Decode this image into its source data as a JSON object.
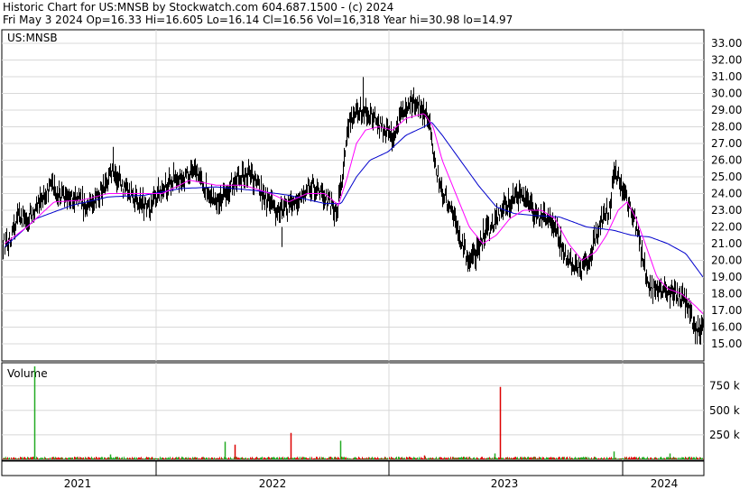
{
  "header": {
    "line1": "Historic Chart for US:MNSB by Stockwatch.com 604.687.1500 - (c) 2024",
    "line2": "Fri May  3 2024   Op=16.33   Hi=16.605   Lo=16.14   Cl=16.56   Vol=16,318   Year hi=30.98   lo=14.97"
  },
  "chart_data": [
    {
      "type": "line",
      "title": "US:MNSB",
      "ylim": [
        14.5,
        33.5
      ],
      "y_ticks": [
        "33.00",
        "32.00",
        "31.00",
        "30.00",
        "29.00",
        "28.00",
        "27.00",
        "26.00",
        "25.00",
        "24.00",
        "23.00",
        "22.00",
        "21.00",
        "20.00",
        "19.00",
        "18.00",
        "17.00",
        "16.00",
        "15.00"
      ],
      "x_tick_labels": [
        "2021",
        "2022",
        "2023",
        "2024"
      ],
      "grid": true,
      "colors": {
        "price": "#000000",
        "ma_short": "#ff00ff",
        "ma_long": "#0000cc"
      },
      "price_anchors": [
        [
          0,
          21.0
        ],
        [
          10,
          21.0
        ],
        [
          20,
          22.5
        ],
        [
          30,
          22.5
        ],
        [
          45,
          23.5
        ],
        [
          55,
          24.5
        ],
        [
          65,
          24.0
        ],
        [
          75,
          23.5
        ],
        [
          85,
          24.0
        ],
        [
          95,
          23.0
        ],
        [
          105,
          23.5
        ],
        [
          115,
          24.5
        ],
        [
          125,
          25.5
        ],
        [
          135,
          24.5
        ],
        [
          145,
          24.0
        ],
        [
          155,
          23.5
        ],
        [
          165,
          23.0
        ],
        [
          175,
          24.0
        ],
        [
          185,
          24.5
        ],
        [
          195,
          25.0
        ],
        [
          205,
          25.0
        ],
        [
          215,
          25.2
        ],
        [
          225,
          24.5
        ],
        [
          235,
          24.0
        ],
        [
          245,
          23.5
        ],
        [
          255,
          24.5
        ],
        [
          265,
          25.0
        ],
        [
          275,
          25.2
        ],
        [
          285,
          24.5
        ],
        [
          295,
          23.5
        ],
        [
          305,
          23.0
        ],
        [
          315,
          23.0
        ],
        [
          325,
          23.5
        ],
        [
          335,
          24.0
        ],
        [
          345,
          24.5
        ],
        [
          355,
          24.0
        ],
        [
          365,
          23.5
        ],
        [
          372,
          22.8
        ],
        [
          378,
          24.5
        ],
        [
          385,
          28.0
        ],
        [
          395,
          29.0
        ],
        [
          405,
          28.8
        ],
        [
          415,
          28.5
        ],
        [
          425,
          27.8
        ],
        [
          435,
          27.5
        ],
        [
          445,
          28.8
        ],
        [
          455,
          29.5
        ],
        [
          465,
          29.3
        ],
        [
          475,
          28.5
        ],
        [
          478,
          27.0
        ],
        [
          482,
          25.5
        ],
        [
          490,
          24.0
        ],
        [
          500,
          23.0
        ],
        [
          510,
          21.0
        ],
        [
          520,
          20.0
        ],
        [
          528,
          20.5
        ],
        [
          535,
          21.5
        ],
        [
          545,
          22.0
        ],
        [
          555,
          23.0
        ],
        [
          565,
          23.5
        ],
        [
          575,
          24.0
        ],
        [
          585,
          23.5
        ],
        [
          595,
          22.5
        ],
        [
          605,
          22.5
        ],
        [
          615,
          22.0
        ],
        [
          625,
          20.5
        ],
        [
          635,
          19.5
        ],
        [
          645,
          19.5
        ],
        [
          655,
          20.5
        ],
        [
          665,
          22.5
        ],
        [
          675,
          23.0
        ],
        [
          680,
          25.5
        ],
        [
          688,
          24.5
        ],
        [
          695,
          23.5
        ],
        [
          703,
          22.5
        ],
        [
          710,
          20.5
        ],
        [
          718,
          18.5
        ],
        [
          730,
          18.0
        ],
        [
          740,
          18.2
        ],
        [
          750,
          18.0
        ],
        [
          760,
          17.5
        ],
        [
          770,
          16.0
        ],
        [
          775,
          15.7
        ],
        [
          779,
          16.5
        ]
      ],
      "ma_short_anchors": [
        [
          5,
          21.0
        ],
        [
          30,
          22.0
        ],
        [
          60,
          23.5
        ],
        [
          90,
          23.6
        ],
        [
          120,
          24.0
        ],
        [
          150,
          24.0
        ],
        [
          180,
          24.0
        ],
        [
          210,
          24.8
        ],
        [
          240,
          24.5
        ],
        [
          270,
          24.5
        ],
        [
          300,
          24.0
        ],
        [
          320,
          23.5
        ],
        [
          340,
          24.0
        ],
        [
          360,
          24.0
        ],
        [
          375,
          23.3
        ],
        [
          385,
          25.0
        ],
        [
          395,
          27.0
        ],
        [
          405,
          27.8
        ],
        [
          420,
          28.0
        ],
        [
          435,
          27.8
        ],
        [
          450,
          28.5
        ],
        [
          470,
          28.8
        ],
        [
          480,
          28.0
        ],
        [
          490,
          26.0
        ],
        [
          505,
          24.0
        ],
        [
          520,
          22.0
        ],
        [
          535,
          21.0
        ],
        [
          550,
          21.5
        ],
        [
          565,
          22.5
        ],
        [
          580,
          23.0
        ],
        [
          600,
          23.0
        ],
        [
          615,
          22.5
        ],
        [
          630,
          21.0
        ],
        [
          645,
          20.0
        ],
        [
          660,
          20.5
        ],
        [
          672,
          21.5
        ],
        [
          685,
          23.0
        ],
        [
          695,
          23.5
        ],
        [
          705,
          22.5
        ],
        [
          715,
          21.0
        ],
        [
          728,
          19.0
        ],
        [
          740,
          18.3
        ],
        [
          755,
          18.0
        ],
        [
          770,
          17.3
        ],
        [
          779,
          16.8
        ]
      ],
      "ma_long_anchors": [
        [
          5,
          20.8
        ],
        [
          40,
          22.5
        ],
        [
          80,
          23.3
        ],
        [
          120,
          23.8
        ],
        [
          160,
          23.9
        ],
        [
          200,
          24.3
        ],
        [
          240,
          24.4
        ],
        [
          280,
          24.2
        ],
        [
          320,
          23.9
        ],
        [
          360,
          23.4
        ],
        [
          378,
          23.4
        ],
        [
          395,
          25.0
        ],
        [
          410,
          26.0
        ],
        [
          430,
          26.5
        ],
        [
          450,
          27.5
        ],
        [
          470,
          28.0
        ],
        [
          478,
          28.3
        ],
        [
          490,
          27.5
        ],
        [
          510,
          26.0
        ],
        [
          530,
          24.5
        ],
        [
          550,
          23.2
        ],
        [
          570,
          22.8
        ],
        [
          590,
          22.7
        ],
        [
          620,
          22.6
        ],
        [
          650,
          22.0
        ],
        [
          680,
          21.8
        ],
        [
          700,
          21.5
        ],
        [
          720,
          21.4
        ],
        [
          740,
          21.0
        ],
        [
          760,
          20.4
        ],
        [
          779,
          19.0
        ]
      ]
    },
    {
      "type": "bar",
      "title": "Volume",
      "y_ticks": [
        "750 k",
        "500 k",
        "250 k"
      ],
      "ylim": [
        0,
        950
      ],
      "spikes": [
        {
          "x": 38,
          "value": 950,
          "color": "#22aa22"
        },
        {
          "x": 249,
          "value": 180,
          "color": "#22aa22"
        },
        {
          "x": 260,
          "value": 150,
          "color": "#dd0000"
        },
        {
          "x": 322,
          "value": 270,
          "color": "#dd0000"
        },
        {
          "x": 377,
          "value": 190,
          "color": "#22aa22"
        },
        {
          "x": 554,
          "value": 740,
          "color": "#dd0000"
        },
        {
          "x": 548,
          "value": 60,
          "color": "#22aa22"
        },
        {
          "x": 122,
          "value": 50,
          "color": "#22aa22"
        },
        {
          "x": 470,
          "value": 40,
          "color": "#dd0000"
        },
        {
          "x": 680,
          "value": 80,
          "color": "#22aa22"
        },
        {
          "x": 742,
          "value": 60,
          "color": "#22aa22"
        }
      ],
      "baseline_colors": [
        "#dd0000",
        "#22aa22"
      ]
    }
  ]
}
